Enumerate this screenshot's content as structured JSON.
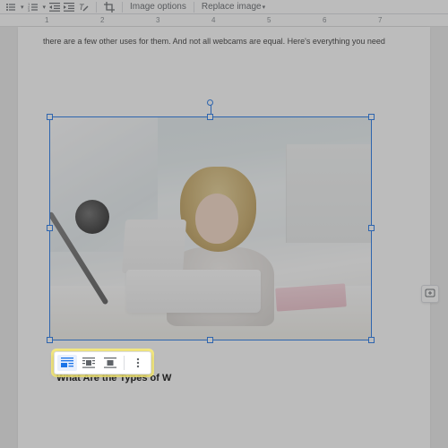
{
  "toolbar": {
    "bulleted_list_name": "bulleted-list-icon",
    "numbered_list_name": "numbered-list-icon",
    "indent_dec_name": "decrease-indent-icon",
    "indent_inc_name": "increase-indent-icon",
    "clear_format_name": "clear-formatting-icon",
    "crop_name": "crop-icon",
    "image_options_label": "Image options",
    "replace_image_label": "Replace image"
  },
  "ruler": {
    "marks": [
      "1",
      "2",
      "3",
      "4",
      "5",
      "6",
      "7"
    ]
  },
  "document": {
    "body_line": "there are a few other uses for them. And not all webcams are equal. Here's everything you need",
    "heading_below_image": "What Are the Types of W",
    "image_alt": "Woman using a white laptop with a webcam in a bright kitchen"
  },
  "wrap_toolbar": {
    "inline_name": "inline-wrap-icon",
    "wrap_name": "wrap-text-icon",
    "break_name": "break-text-icon",
    "more_name": "more-options-icon",
    "active": "inline"
  },
  "colors": {
    "selection_blue": "#1a73e8",
    "highlight_yellow": "#fff278"
  },
  "side": {
    "add_comment_name": "add-comment-icon"
  }
}
